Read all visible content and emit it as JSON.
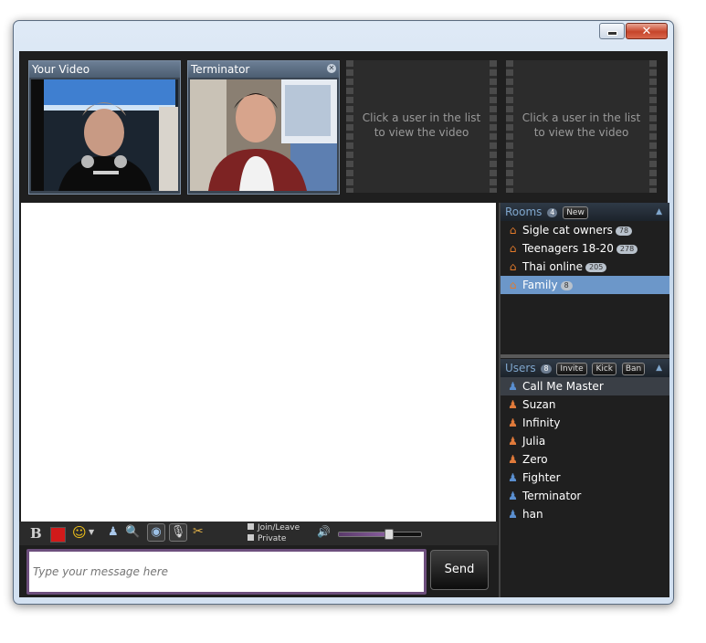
{
  "window": {
    "close_glyph": "x",
    "minimize_glyph": "_"
  },
  "videos": {
    "slot1": {
      "title": "Your Video"
    },
    "slot2": {
      "title": "Terminator",
      "close_glyph": "x"
    },
    "empty_message": "Click a user in the list to view the video"
  },
  "rooms": {
    "label": "Rooms",
    "count": "4",
    "new_label": "New",
    "items": [
      {
        "name": "Sigle cat owners",
        "count": "78"
      },
      {
        "name": "Teenagers 18-20",
        "count": "278"
      },
      {
        "name": "Thai online",
        "count": "205"
      },
      {
        "name": "Family",
        "count": "8"
      }
    ]
  },
  "users": {
    "label": "Users",
    "count": "8",
    "invite_label": "Invite",
    "kick_label": "Kick",
    "ban_label": "Ban",
    "items": [
      {
        "name": "Call Me Master"
      },
      {
        "name": "Suzan"
      },
      {
        "name": "Infinity"
      },
      {
        "name": "Julia"
      },
      {
        "name": "Zero"
      },
      {
        "name": "Fighter"
      },
      {
        "name": "Terminator"
      },
      {
        "name": "han"
      }
    ]
  },
  "toolbar": {
    "bold_label": "B",
    "join_leave_label": "Join/Leave",
    "private_label": "Private",
    "volume_level": 0.6
  },
  "compose": {
    "placeholder": "Type your message here",
    "send_label": "Send"
  }
}
